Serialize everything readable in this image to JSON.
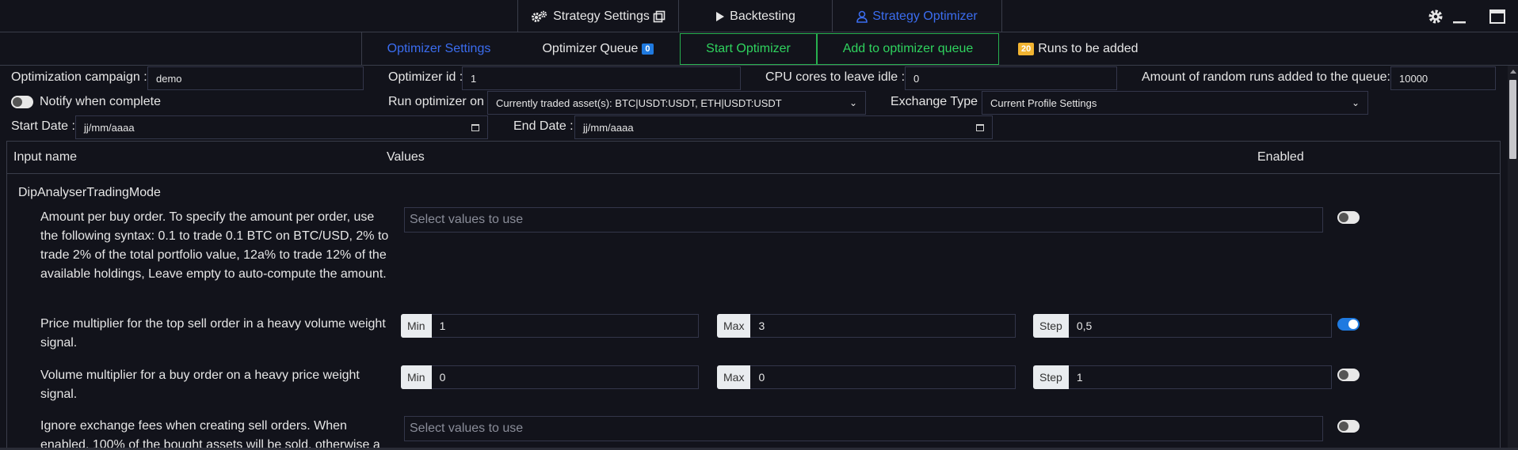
{
  "topnav": {
    "tabs": [
      {
        "label": "Strategy Settings",
        "icon": "gears-icon",
        "trailing_icon": "external-window-icon"
      },
      {
        "label": "Backtesting",
        "icon": "play-icon"
      },
      {
        "label": "Strategy Optimizer",
        "icon": "user-icon"
      }
    ],
    "active_tab": "Strategy Optimizer",
    "window_controls": [
      "gear-icon",
      "minimize-icon",
      "maximize-icon"
    ]
  },
  "subnav": {
    "optimizer_settings": "Optimizer Settings",
    "optimizer_queue": "Optimizer Queue",
    "queue_count": "0",
    "start_optimizer": "Start Optimizer",
    "add_to_queue": "Add to optimizer queue",
    "runs_count": "20",
    "runs_label": "Runs to be added"
  },
  "settings": {
    "campaign_label": "Optimization campaign :",
    "campaign_value": "demo",
    "optimizer_id_label": "Optimizer id :",
    "optimizer_id_value": "1",
    "cpu_label": "CPU cores to leave idle :",
    "cpu_value": "0",
    "random_runs_label": "Amount of random runs added to the queue:",
    "random_runs_value": "10000",
    "notify_label": "Notify when complete",
    "notify_enabled": false,
    "run_on_label": "Run optimizer on",
    "run_on_value": "Currently traded asset(s): BTC|USDT:USDT, ETH|USDT:USDT",
    "exchange_type_label": "Exchange Type",
    "exchange_type_value": "Current Profile Settings",
    "start_date_label": "Start Date :",
    "start_date_value": "jj/mm/aaaa",
    "end_date_label": "End Date :",
    "end_date_value": "jj/mm/aaaa"
  },
  "table": {
    "headers": {
      "input_name": "Input name",
      "values": "Values",
      "enabled": "Enabled"
    },
    "group": "DipAnalyserTradingMode",
    "rows": [
      {
        "description": "Amount per buy order. To specify the amount per order, use the following syntax: 0.1 to trade 0.1 BTC on BTC/USD, 2% to trade 2% of the total portfolio value, 12a% to trade 12% of the available holdings, Leave empty to auto-compute the amount.",
        "placeholder": "Select values to use",
        "enabled": false
      },
      {
        "description": "Price multiplier for the top sell order in a heavy volume weight signal.",
        "min_label": "Min",
        "min": "1",
        "max_label": "Max",
        "max": "3",
        "step_label": "Step",
        "step": "0,5",
        "enabled": true
      },
      {
        "description": "Volume multiplier for a buy order on a heavy price weight signal.",
        "min_label": "Min",
        "min": "0",
        "max_label": "Max",
        "max": "0",
        "step_label": "Step",
        "step": "1",
        "enabled": false
      },
      {
        "description": "Ignore exchange fees when creating sell orders. When enabled, 100% of the bought assets will be sold, otherwise a",
        "placeholder": "Select values to use",
        "enabled": false
      }
    ]
  },
  "colors": {
    "background": "#12131b",
    "accent_blue": "#3b6df0",
    "green": "#2fd35e",
    "badge_blue": "#1f7ae0",
    "badge_yellow": "#f2b431"
  }
}
